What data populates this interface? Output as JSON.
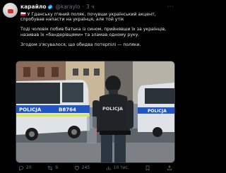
{
  "author": {
    "display_name": "карайло",
    "handle": "@karaylo",
    "separator": "·",
    "time": "3 ч"
  },
  "tweet": {
    "paragraph_1": "🇵🇱 У Гданську п'яний поляк, почувши український акцент, спробував напасти на українця, але той утік",
    "paragraph_2": "Тоді чоловік побив батька із сином, прийнявши їх за українців, називав їх «бандерівцями» та зламав одному руку.",
    "paragraph_3": "Згодом з'ясувалося, що обидва потерпілі — поляки."
  },
  "media": {
    "van_label": "POLICJA",
    "van_number": "B8764",
    "van_label_right": "POLICJA"
  },
  "actions": {
    "reply_count": "20",
    "retweet_count": "9",
    "like_count": "245",
    "views_count": "10 тис."
  },
  "colors": {
    "background": "#000000",
    "text": "#e7e9ea",
    "muted": "#71767b",
    "verified": "#1d9bf0"
  }
}
